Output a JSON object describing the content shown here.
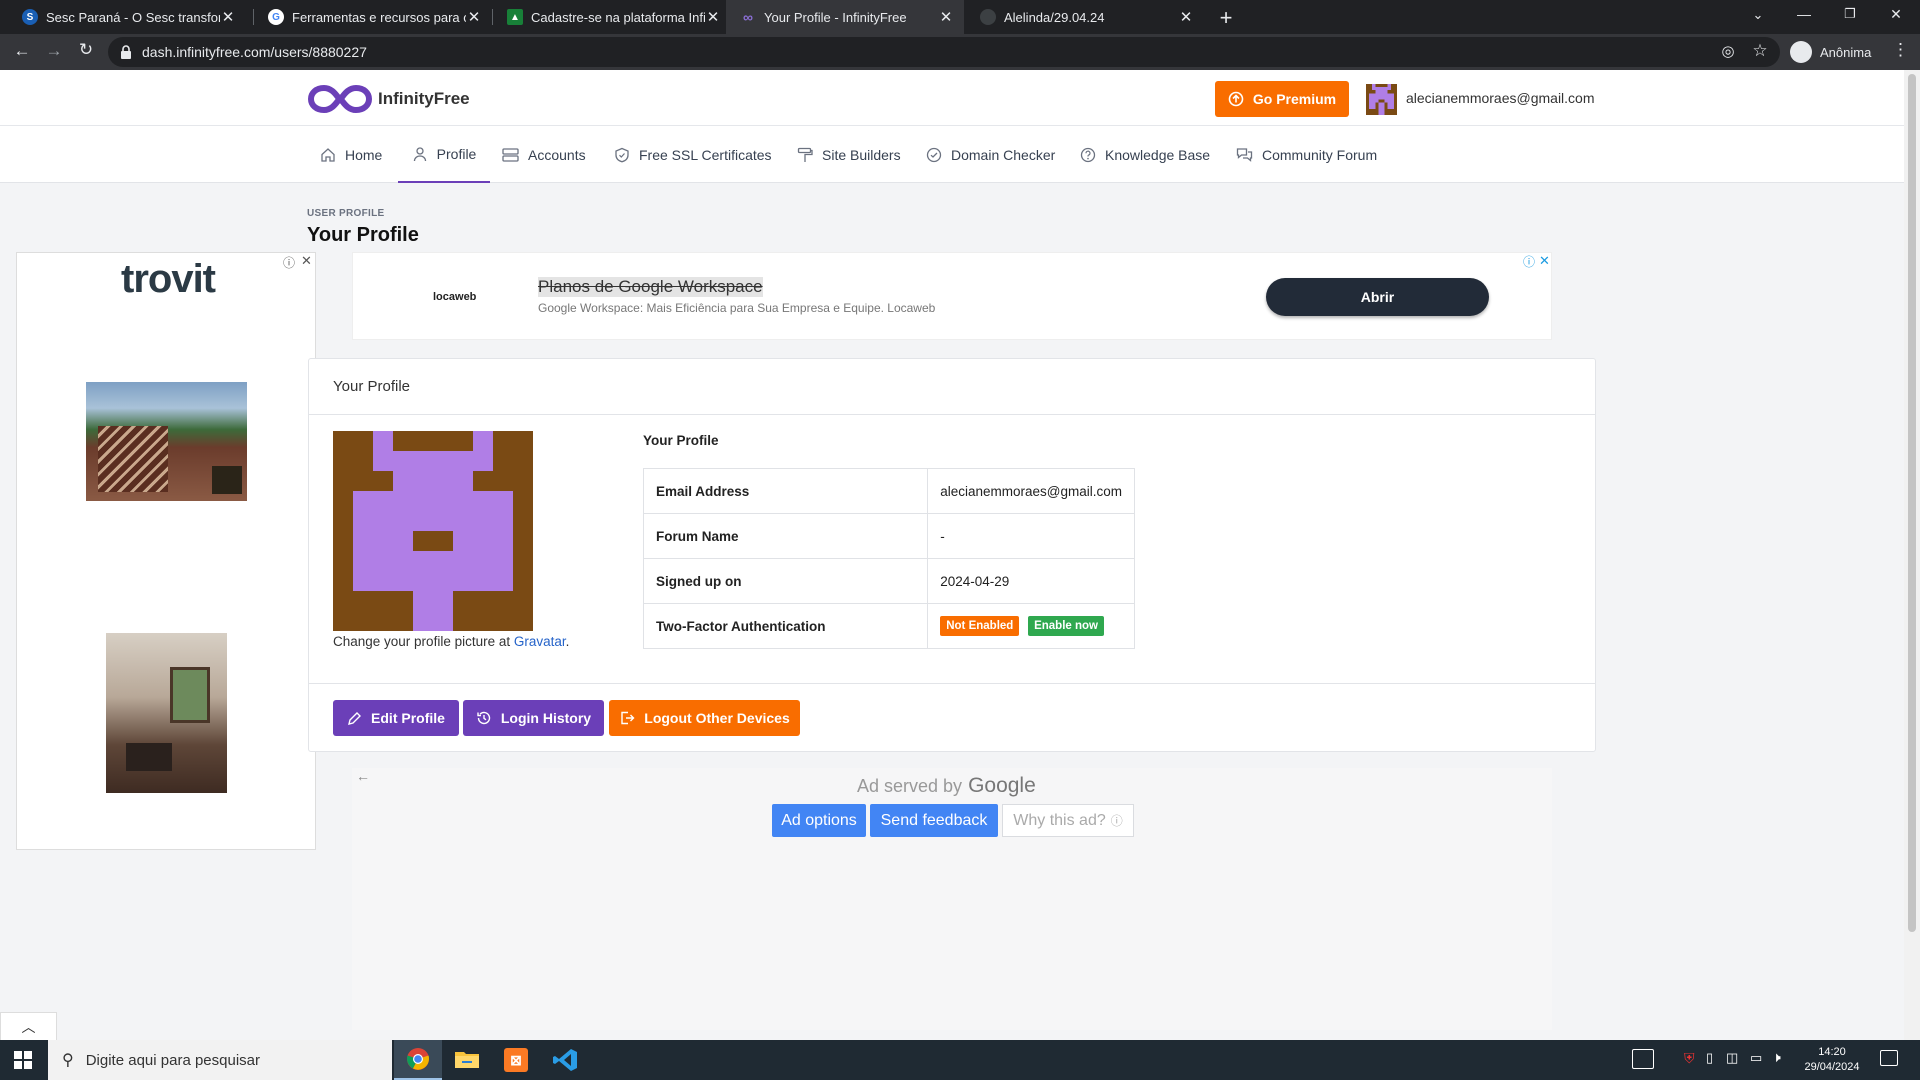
{
  "browser": {
    "tabs": [
      {
        "title": "Sesc Paraná - O Sesc transforma",
        "favicon": "S",
        "favicon_color": "#1a5fb4",
        "active": false
      },
      {
        "title": "Ferramentas e recursos para o gestor",
        "favicon": "G",
        "favicon_color": "#ffffff",
        "active": false
      },
      {
        "title": "Cadastre-se na plataforma Infinity",
        "favicon": "C",
        "favicon_color": "#188038",
        "active": false
      },
      {
        "title": "Your Profile - InfinityFree",
        "favicon": "∞",
        "favicon_color": "#6b3fb8",
        "active": true
      },
      {
        "title": "Alelinda/29.04.24",
        "favicon": "",
        "favicon_color": "#35363a",
        "active": false
      }
    ],
    "url": "dash.infinityfree.com/users/8880227",
    "profile_label": "Anônima",
    "icons": [
      "back-icon",
      "forward-icon",
      "reload-icon",
      "lock-icon",
      "eye-off-icon",
      "star-icon",
      "incognito-icon",
      "menu-icon",
      "new-tab-icon",
      "chevron-down-icon",
      "minimize-icon",
      "restore-icon",
      "close-window-icon"
    ]
  },
  "site": {
    "logo_text": "InfinityFree",
    "premium_label": "Go Premium",
    "user_email": "alecianemmoraes@gmail.com",
    "brand_color": "#6b3fb8",
    "accent_orange": "#f96d00"
  },
  "nav": {
    "items": [
      {
        "label": "Home",
        "icon": "home-icon"
      },
      {
        "label": "Profile",
        "icon": "user-icon",
        "active": true
      },
      {
        "label": "Accounts",
        "icon": "server-icon"
      },
      {
        "label": "Free SSL Certificates",
        "icon": "shield-icon"
      },
      {
        "label": "Site Builders",
        "icon": "paint-roller-icon"
      },
      {
        "label": "Domain Checker",
        "icon": "check-circle-icon"
      },
      {
        "label": "Knowledge Base",
        "icon": "question-circle-icon"
      },
      {
        "label": "Community Forum",
        "icon": "chat-icon"
      }
    ]
  },
  "page": {
    "eyebrow": "USER PROFILE",
    "title": "Your Profile"
  },
  "ads": {
    "top": {
      "brand": "locaweb",
      "headline": "Planos de Google Workspace",
      "description": "Google Workspace: Mais Eficiência para Sua Empresa e Equipe. Locaweb",
      "cta": "Abrir"
    },
    "left": {
      "brand": "trovit"
    },
    "bottom": {
      "served_by": "Ad served by",
      "google": "Google",
      "ad_options": "Ad options",
      "send_feedback": "Send feedback",
      "why_this_ad": "Why this ad?"
    }
  },
  "profile_card": {
    "header": "Your Profile",
    "section_title": "Your Profile",
    "gravatar_text": "Change your profile picture at",
    "gravatar_link": "Gravatar",
    "gravatar_suffix": ".",
    "rows": [
      {
        "key": "Email Address",
        "value": "alecianemmoraes@gmail.com"
      },
      {
        "key": "Forum Name",
        "value": "-"
      },
      {
        "key": "Signed up on",
        "value": "2024-04-29"
      },
      {
        "key": "Two-Factor Authentication",
        "value": ""
      }
    ],
    "twofa_status": "Not Enabled",
    "twofa_action": "Enable now",
    "buttons": {
      "edit": "Edit Profile",
      "history": "Login History",
      "logout": "Logout Other Devices"
    }
  },
  "taskbar": {
    "search_placeholder": "Digite aqui para pesquisar",
    "time": "14:20",
    "date": "29/04/2024",
    "apps": [
      "chrome-icon",
      "file-explorer-icon",
      "xampp-icon",
      "vscode-icon"
    ]
  }
}
